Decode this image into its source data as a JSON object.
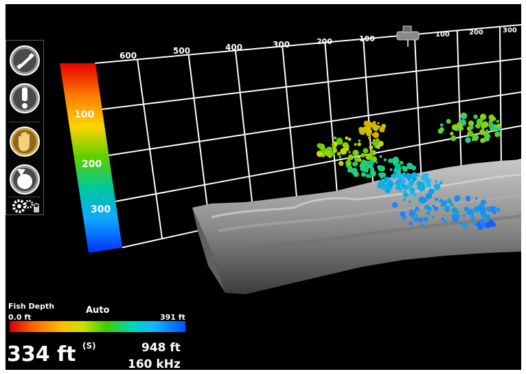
{
  "colors": {
    "scale_top": "#e80000",
    "scale_bottom": "#0030ff",
    "grid": "#ffffff",
    "background": "#000000"
  },
  "grid": {
    "x_ticks": [
      "600",
      "500",
      "400",
      "300",
      "200",
      "100"
    ],
    "x_ticks_right": [
      "100",
      "200",
      "300"
    ],
    "depth_ticks": [
      "100",
      "200",
      "300"
    ]
  },
  "toolbar": {
    "buttons": [
      {
        "name": "boat-view-icon"
      },
      {
        "name": "alert-icon"
      },
      {
        "name": "hand-pan-icon"
      },
      {
        "name": "rotate-icon"
      },
      {
        "name": "settings-gears-icon"
      }
    ]
  },
  "legend": {
    "title": "Fish Depth",
    "mode": "Auto",
    "min": "0.0 ft",
    "max": "391 ft"
  },
  "readout": {
    "depth": "334 ft",
    "depth_flag": "(S)",
    "range": "948 ft",
    "frequency": "160 kHz"
  }
}
